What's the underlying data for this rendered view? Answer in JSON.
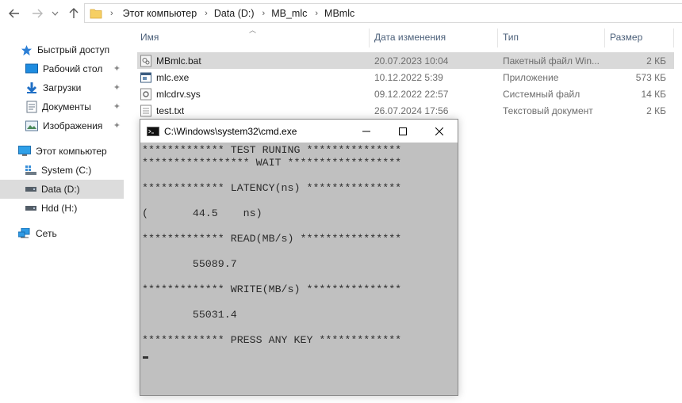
{
  "breadcrumb": [
    "Этот компьютер",
    "Data (D:)",
    "MB_mlc",
    "MBmlc"
  ],
  "nav": {
    "quick_access": "Быстрый доступ",
    "desktop": "Рабочий стол",
    "downloads": "Загрузки",
    "documents": "Документы",
    "pictures": "Изображения",
    "this_pc": "Этот компьютер",
    "system_c": "System (C:)",
    "data_d": "Data (D:)",
    "hdd_h": "Hdd (H:)",
    "network": "Сеть"
  },
  "columns": {
    "name": "Имя",
    "date": "Дата изменения",
    "type": "Тип",
    "size": "Размер"
  },
  "files": [
    {
      "name": "MBmlc.bat",
      "date": "20.07.2023 10:04",
      "type": "Пакетный файл Win...",
      "size": "2 КБ",
      "icon": "bat-file-icon"
    },
    {
      "name": "mlc.exe",
      "date": "10.12.2022 5:39",
      "type": "Приложение",
      "size": "573 КБ",
      "icon": "exe-file-icon"
    },
    {
      "name": "mlcdrv.sys",
      "date": "09.12.2022 22:57",
      "type": "Системный файл",
      "size": "14 КБ",
      "icon": "sys-file-icon"
    },
    {
      "name": "test.txt",
      "date": "26.07.2024 17:56",
      "type": "Текстовый документ",
      "size": "2 КБ",
      "icon": "txt-file-icon"
    }
  ],
  "cmd": {
    "title": "C:\\Windows\\system32\\cmd.exe",
    "lines": [
      "************* TEST RUNING ***************",
      "***************** WAIT ******************",
      "************* LATENCY(ns) ***************",
      "(       44.5    ns)",
      "************* READ(MB/s) ****************",
      "        55089.7",
      "************* WRITE(MB/s) ***************",
      "        55031.4",
      "************* PRESS ANY KEY *************"
    ]
  },
  "colors": {
    "selection": "#d9d9d9",
    "console_bg": "#c0c0c0",
    "header_text": "#4c607a",
    "accent_blue": "#1f6fc5"
  }
}
